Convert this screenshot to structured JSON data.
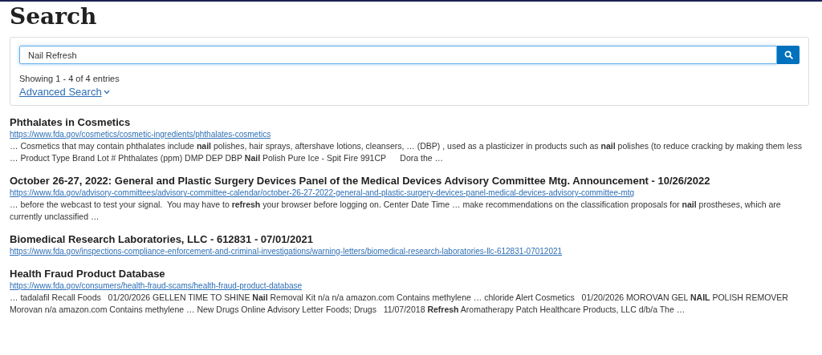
{
  "page_title": "Search",
  "search": {
    "value": "Nail Refresh",
    "summary": "Showing 1 - 4 of 4 entries",
    "advanced_link": "Advanced Search"
  },
  "results": [
    {
      "title": "Phthalates in Cosmetics",
      "url": "https://www.fda.gov/cosmetics/cosmetic-ingredients/phthalates-cosmetics",
      "snippet": "… Cosmetics that may contain phthalates include **nail** polishes, hair sprays, aftershave lotions, cleansers, … (DBP) , used as a plasticizer in products such as **nail** polishes (to reduce cracking by making them less … Product Type Brand Lot # Phthalates (ppm) DMP DEP DBP **Nail** Polish Pure Ice - Spit Fire 991CP      Dora the …"
    },
    {
      "title": "October 26-27, 2022: General and Plastic Surgery Devices Panel of the Medical Devices Advisory Committee Mtg. Announcement - 10/26/2022",
      "url": "https://www.fda.gov/advisory-committees/advisory-committee-calendar/october-26-27-2022-general-and-plastic-surgery-devices-panel-medical-devices-advisory-committee-mtg",
      "snippet": "… before the webcast to test your signal.  You may have to **refresh** your browser before logging on. Center Date Time … make recommendations on the classification proposals for **nail** prostheses, which are currently unclassified …"
    },
    {
      "title": "Biomedical Research Laboratories, LLC - 612831 - 07/01/2021",
      "url": "https://www.fda.gov/inspections-compliance-enforcement-and-criminal-investigations/warning-letters/biomedical-research-laboratories-llc-612831-07012021"
    },
    {
      "title": "Health Fraud Product Database",
      "url": "https://www.fda.gov/consumers/health-fraud-scams/health-fraud-product-database",
      "snippet": "… tadalafil Recall Foods   01/20/2026 GELLEN TIME TO SHINE **Nail** Removal Kit n/a n/a amazon.com Contains methylene … chloride Alert Cosmetics   01/20/2026 MOROVAN GEL **NAIL** POLISH REMOVER Morovan n/a amazon.com Contains methylene … New Drugs Online Advisory Letter Foods; Drugs   11/07/2018 **Refresh** Aromatherapy Patch Healthcare Products, LLC d/b/a The …"
    }
  ]
}
